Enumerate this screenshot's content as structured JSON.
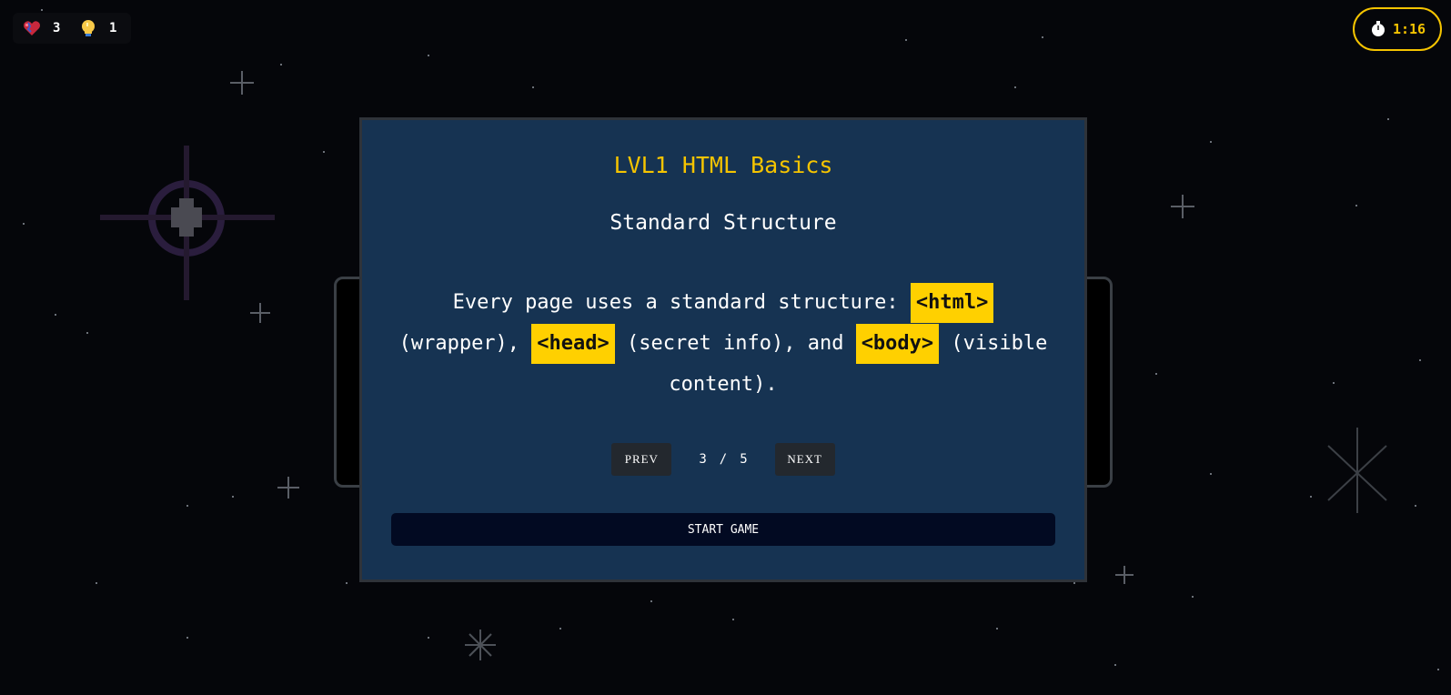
{
  "hud": {
    "lives": {
      "icon": "heart-icon",
      "value": "3"
    },
    "hints": {
      "icon": "lightbulb-icon",
      "value": "1"
    },
    "timer": {
      "icon": "stopwatch-icon",
      "value": "1:16"
    }
  },
  "panel": {
    "level_title": "LVL1 HTML Basics",
    "slide_title": "Standard Structure",
    "description": {
      "part1": "Every page uses a standard structure: ",
      "tag1": "<html>",
      "part2": " (wrapper), ",
      "tag2": "<head>",
      "part3": " (secret info), and ",
      "tag3": "<body>",
      "part4": " (visible content)."
    },
    "pager": {
      "prev_label": "PREV",
      "current": "3",
      "separator": "/",
      "total": "5",
      "next_label": "NEXT"
    },
    "start_label": "START GAME"
  },
  "colors": {
    "accent": "#f5c400",
    "panel_bg": "#163352",
    "tag_bg": "#ffd000",
    "page_bg": "#05060a"
  }
}
